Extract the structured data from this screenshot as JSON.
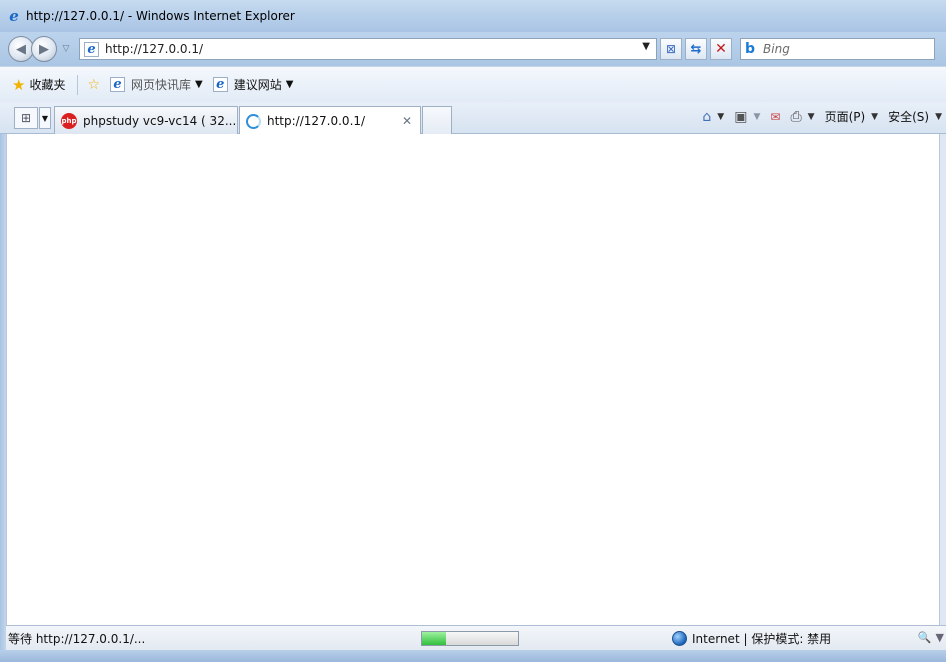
{
  "window": {
    "title": "http://127.0.0.1/ - Windows Internet Explorer"
  },
  "navigation": {
    "address": "http://127.0.0.1/",
    "search_placeholder": "Bing"
  },
  "favorites_bar": {
    "favorites_label": "收藏夹",
    "items": [
      {
        "label": "网页快讯库",
        "has_dropdown": true
      },
      {
        "label": "建议网站",
        "has_dropdown": true
      }
    ]
  },
  "tabs": [
    {
      "label": "phpstudy vc9-vc14 ( 32...",
      "active": false,
      "icon": "phpstudy-icon"
    },
    {
      "label": "http://127.0.0.1/",
      "active": true,
      "icon": "loading-icon"
    }
  ],
  "command_bar": {
    "page_label": "页面(P)",
    "safety_label": "安全(S)"
  },
  "status_bar": {
    "status_text": "等待 http://127.0.0.1/...",
    "progress_percent": 25,
    "zone_text": "Internet | 保护模式: 禁用"
  }
}
